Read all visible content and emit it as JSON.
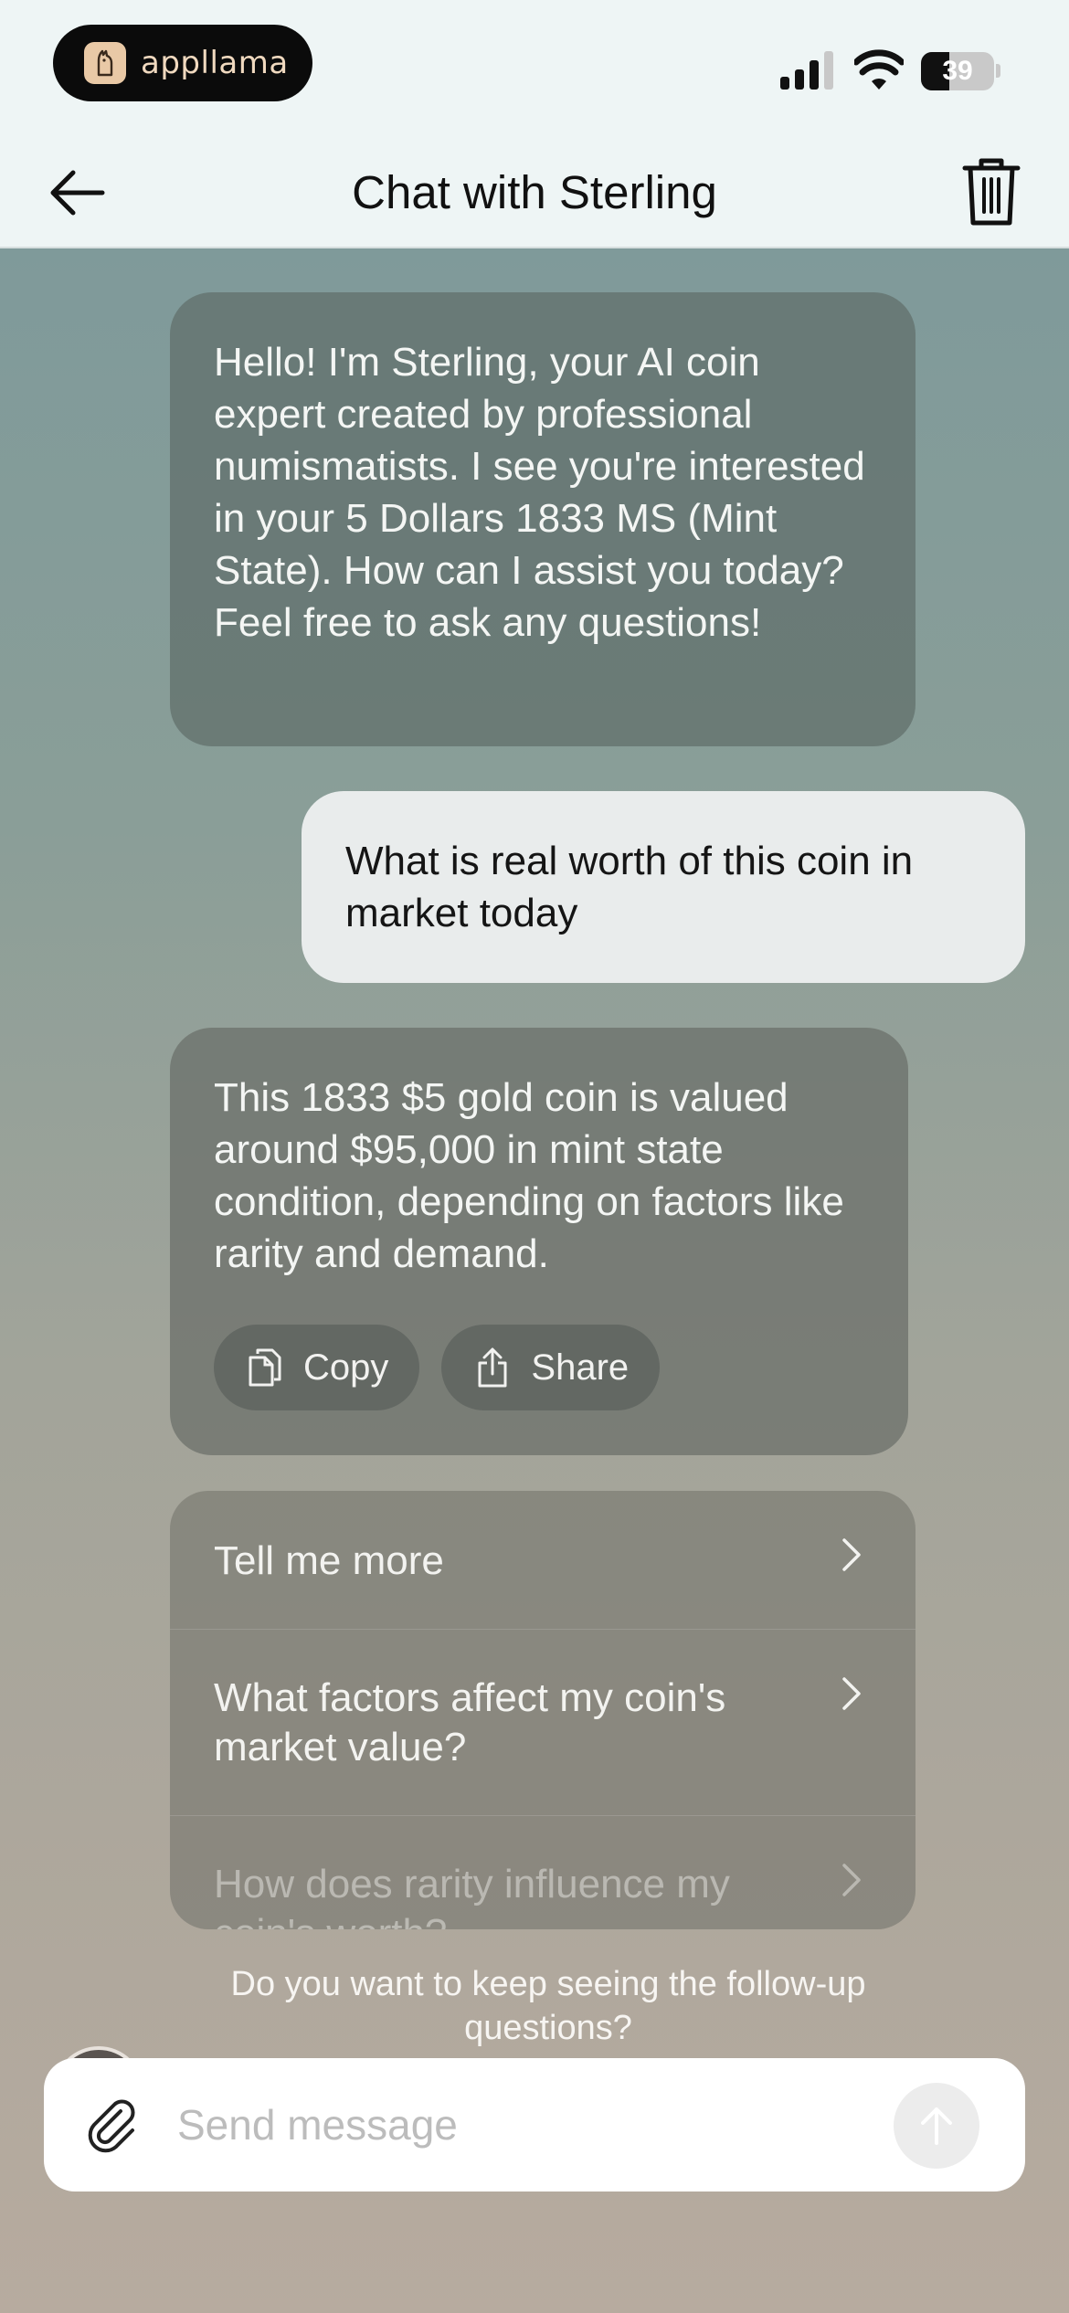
{
  "status_bar": {
    "app_pill_label": "appllama",
    "battery_level": "39",
    "battery_percent": 39
  },
  "nav": {
    "title": "Chat with Sterling"
  },
  "messages": [
    {
      "role": "assistant",
      "text": "Hello! I'm Sterling, your AI coin expert created by professional numismatists. I see you're interested in your 5 Dollars 1833 MS (Mint State). How can I assist you today? Feel free to ask any questions!"
    },
    {
      "role": "user",
      "text": "What is real worth of this coin in market today"
    },
    {
      "role": "assistant",
      "text": "This 1833 $5 gold coin is valued around $95,000 in mint state condition, depending on factors like rarity and demand.",
      "actions": {
        "copy_label": "Copy",
        "share_label": "Share"
      }
    }
  ],
  "suggestions": [
    "Tell me more",
    "What factors affect my coin's market value?",
    "How does rarity influence my coin's worth?"
  ],
  "followup_prompt": "Do you want to keep seeing the follow-up questions?",
  "composer": {
    "placeholder": "Send message",
    "value": ""
  }
}
